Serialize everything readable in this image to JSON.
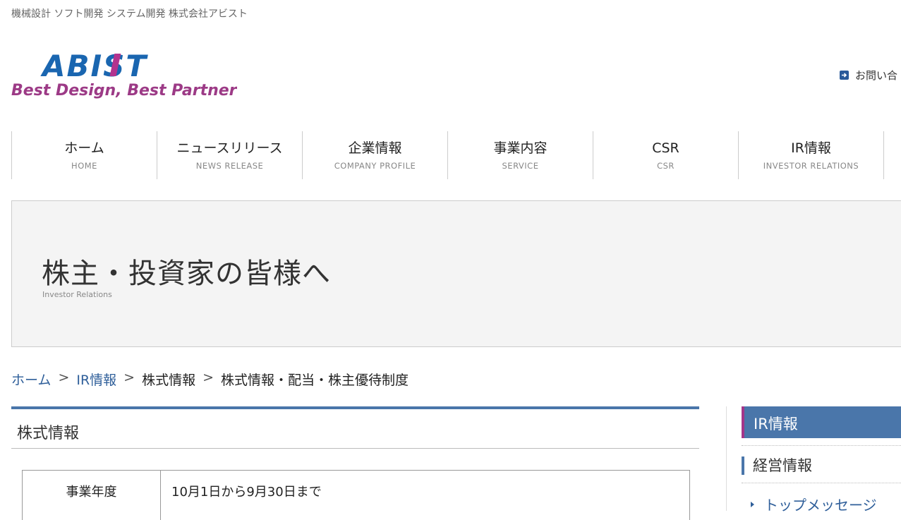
{
  "header": {
    "tagline": "機械設計 ソフト開発 システム開発 株式会社アビスト",
    "logo": {
      "wordmark": "ABIST",
      "slogan": "Best Design,  Best Partner",
      "colors": {
        "wordmark": "#1a66b0",
        "accent": "#b3338e",
        "slogan": "#9c3a86"
      }
    },
    "contact_label": "お問い合"
  },
  "nav": [
    {
      "jp": "ホーム",
      "en": "HOME"
    },
    {
      "jp": "ニュースリリース",
      "en": "NEWS RELEASE"
    },
    {
      "jp": "企業情報",
      "en": "COMPANY PROFILE"
    },
    {
      "jp": "事業内容",
      "en": "SERVICE"
    },
    {
      "jp": "CSR",
      "en": "CSR"
    },
    {
      "jp": "IR情報",
      "en": "INVESTOR RELATIONS"
    }
  ],
  "hero": {
    "title": "株主・投資家の皆様へ",
    "subtitle": "Investor Relations"
  },
  "breadcrumb": {
    "home": "ホーム",
    "sep": ">",
    "ir": "IR情報",
    "stock": "株式情報",
    "current": "株式情報・配当・株主優待制度"
  },
  "section": {
    "heading": "株式情報",
    "rows": [
      {
        "label": "事業年度",
        "value": "10月1日から9月30日まで"
      }
    ]
  },
  "sidebar": {
    "heading": "IR情報",
    "sub": "経営情報",
    "link": "トップメッセージ"
  },
  "colors": {
    "accent_blue": "#4a76aa",
    "link": "#2f5f9a",
    "sidebar_accent": "#a3368a"
  }
}
